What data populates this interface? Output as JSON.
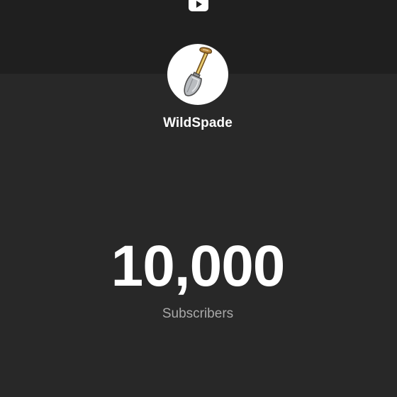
{
  "header": {
    "platform_icon": "youtube-play-icon"
  },
  "channel": {
    "avatar_icon": "shovel-icon",
    "name": "WildSpade"
  },
  "stats": {
    "subscriber_count": "10,000",
    "subscriber_label": "Subscribers"
  },
  "colors": {
    "background": "#282828",
    "header_band": "#1f1f1f",
    "text_primary": "#ffffff",
    "text_secondary": "#a8a8a8",
    "avatar_background": "#ffffff"
  }
}
